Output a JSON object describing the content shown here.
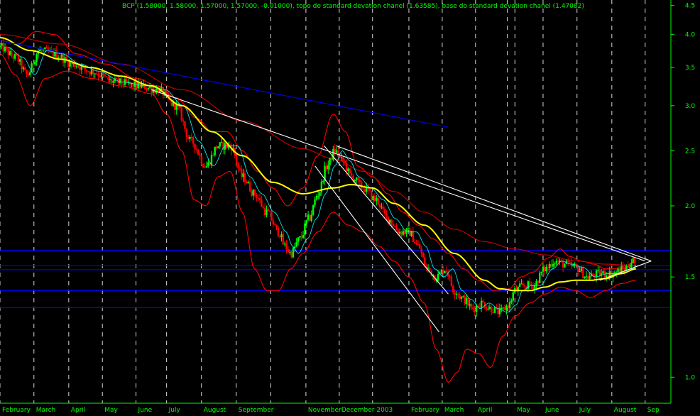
{
  "header": {
    "title": "BCP (1.58000, 1.58000, 1.57000, 1.57000, -0.01000), topo do standard devation chanel (1.63585), base do standard devation chanel (1.47082)"
  },
  "colors": {
    "background": "#000000",
    "grid": "#ffffff",
    "axis": "#00ff00",
    "title": "#00ff00",
    "candle_up": "#00ff00",
    "candle_down": "#ff0000",
    "ma_long": "#ffff00",
    "bands": "#ff0000",
    "hlines": "#0000ff",
    "trend_white": "#ffffff",
    "trend_blue": "#0000ff"
  },
  "chart_data": {
    "type": "line",
    "yscale": "log",
    "ylim": [
      0.9,
      4.6
    ],
    "yticks": [
      {
        "v": 1.0,
        "label": "1.0"
      },
      {
        "v": 1.5,
        "label": "1.5"
      },
      {
        "v": 2.0,
        "label": "2.0"
      },
      {
        "v": 2.5,
        "label": "2.5"
      },
      {
        "v": 3.0,
        "label": "3.0"
      },
      {
        "v": 3.5,
        "label": "3.5"
      },
      {
        "v": 4.0,
        "label": "4.0"
      },
      {
        "v": 4.5,
        "label": "4.5"
      }
    ],
    "xlim": [
      0,
      22.15
    ],
    "months": [
      {
        "label": "February",
        "x": 0.0
      },
      {
        "label": "March",
        "x": 1.12
      },
      {
        "label": "April",
        "x": 2.27
      },
      {
        "label": "May",
        "x": 3.38
      },
      {
        "label": "June",
        "x": 4.49
      },
      {
        "label": "July",
        "x": 5.5
      },
      {
        "label": "August",
        "x": 6.65
      },
      {
        "label": "September",
        "x": 7.8
      },
      {
        "label": "",
        "x": 8.94
      },
      {
        "label": "November",
        "x": 10.1
      },
      {
        "label": "December 2003",
        "x": 11.2
      },
      {
        "label": "",
        "x": 12.3
      },
      {
        "label": "February",
        "x": 13.5
      },
      {
        "label": "March",
        "x": 14.6
      },
      {
        "label": "April",
        "x": 15.7
      },
      {
        "label": "",
        "x": 16.75
      },
      {
        "label": "May",
        "x": 17.0
      },
      {
        "label": "June",
        "x": 17.93
      },
      {
        "label": "July",
        "x": 19.05
      },
      {
        "label": "August",
        "x": 20.2
      },
      {
        "label": "Sep",
        "x": 21.3
      }
    ],
    "price_anchors": [
      [
        0.0,
        3.8
      ],
      [
        0.5,
        3.65
      ],
      [
        0.9,
        3.4
      ],
      [
        1.3,
        3.75
      ],
      [
        1.8,
        3.7
      ],
      [
        2.4,
        3.55
      ],
      [
        3.0,
        3.45
      ],
      [
        3.8,
        3.3
      ],
      [
        4.6,
        3.25
      ],
      [
        5.2,
        3.2
      ],
      [
        5.8,
        3.0
      ],
      [
        6.3,
        2.6
      ],
      [
        6.8,
        2.35
      ],
      [
        7.2,
        2.55
      ],
      [
        7.6,
        2.55
      ],
      [
        8.0,
        2.25
      ],
      [
        8.4,
        2.1
      ],
      [
        8.8,
        1.95
      ],
      [
        9.2,
        1.8
      ],
      [
        9.4,
        1.7
      ],
      [
        9.6,
        1.65
      ],
      [
        9.9,
        1.75
      ],
      [
        10.2,
        1.9
      ],
      [
        10.5,
        2.1
      ],
      [
        10.8,
        2.35
      ],
      [
        11.05,
        2.5
      ],
      [
        11.3,
        2.4
      ],
      [
        11.6,
        2.25
      ],
      [
        12.0,
        2.15
      ],
      [
        12.4,
        2.05
      ],
      [
        12.8,
        1.9
      ],
      [
        13.2,
        1.8
      ],
      [
        13.5,
        1.8
      ],
      [
        13.8,
        1.7
      ],
      [
        14.1,
        1.55
      ],
      [
        14.4,
        1.5
      ],
      [
        14.7,
        1.55
      ],
      [
        15.0,
        1.42
      ],
      [
        15.3,
        1.37
      ],
      [
        15.6,
        1.32
      ],
      [
        15.9,
        1.35
      ],
      [
        16.2,
        1.32
      ],
      [
        16.5,
        1.3
      ],
      [
        16.8,
        1.34
      ],
      [
        17.0,
        1.42
      ],
      [
        17.3,
        1.45
      ],
      [
        17.6,
        1.45
      ],
      [
        18.0,
        1.55
      ],
      [
        18.3,
        1.6
      ],
      [
        18.6,
        1.58
      ],
      [
        19.0,
        1.56
      ],
      [
        19.4,
        1.5
      ],
      [
        19.8,
        1.52
      ],
      [
        20.2,
        1.52
      ],
      [
        20.6,
        1.55
      ],
      [
        20.9,
        1.6
      ],
      [
        21.0,
        1.57
      ]
    ],
    "ma_long_anchors": [
      [
        0.0,
        3.95
      ],
      [
        1.0,
        3.75
      ],
      [
        2.0,
        3.62
      ],
      [
        3.0,
        3.5
      ],
      [
        4.0,
        3.38
      ],
      [
        5.0,
        3.25
      ],
      [
        6.0,
        3.0
      ],
      [
        7.0,
        2.7
      ],
      [
        8.0,
        2.45
      ],
      [
        9.0,
        2.2
      ],
      [
        10.0,
        2.1
      ],
      [
        11.0,
        2.15
      ],
      [
        11.6,
        2.18
      ],
      [
        12.3,
        2.15
      ],
      [
        13.0,
        2.02
      ],
      [
        14.0,
        1.85
      ],
      [
        15.0,
        1.65
      ],
      [
        16.0,
        1.48
      ],
      [
        16.5,
        1.43
      ],
      [
        17.0,
        1.42
      ],
      [
        17.5,
        1.42
      ],
      [
        18.0,
        1.44
      ],
      [
        18.5,
        1.47
      ],
      [
        19.0,
        1.48
      ],
      [
        19.5,
        1.48
      ],
      [
        20.0,
        1.49
      ],
      [
        20.5,
        1.52
      ],
      [
        21.0,
        1.55
      ]
    ],
    "band_upper_anchors": [
      [
        0.0,
        3.9
      ],
      [
        0.6,
        3.85
      ],
      [
        1.2,
        4.05
      ],
      [
        1.8,
        4.0
      ],
      [
        2.5,
        3.7
      ],
      [
        3.5,
        3.55
      ],
      [
        4.5,
        3.35
      ],
      [
        5.2,
        3.25
      ],
      [
        5.8,
        3.1
      ],
      [
        6.5,
        2.85
      ],
      [
        7.0,
        2.7
      ],
      [
        7.5,
        2.7
      ],
      [
        8.0,
        2.5
      ],
      [
        8.5,
        2.3
      ],
      [
        9.0,
        2.15
      ],
      [
        9.5,
        2.0
      ],
      [
        10.0,
        2.15
      ],
      [
        10.5,
        2.45
      ],
      [
        11.0,
        2.9
      ],
      [
        11.4,
        2.7
      ],
      [
        11.8,
        2.35
      ],
      [
        12.3,
        2.25
      ],
      [
        12.8,
        2.1
      ],
      [
        13.3,
        1.95
      ],
      [
        13.8,
        1.85
      ],
      [
        14.3,
        1.75
      ],
      [
        14.8,
        1.65
      ],
      [
        15.3,
        1.55
      ],
      [
        15.8,
        1.48
      ],
      [
        16.3,
        1.42
      ],
      [
        16.8,
        1.43
      ],
      [
        17.2,
        1.5
      ],
      [
        17.6,
        1.53
      ],
      [
        18.1,
        1.62
      ],
      [
        18.5,
        1.68
      ],
      [
        18.8,
        1.63
      ],
      [
        19.2,
        1.6
      ],
      [
        19.6,
        1.58
      ],
      [
        20.0,
        1.55
      ],
      [
        20.5,
        1.55
      ],
      [
        21.0,
        1.6
      ]
    ],
    "band_lower_anchors": [
      [
        0.0,
        3.7
      ],
      [
        0.5,
        3.4
      ],
      [
        1.0,
        3.0
      ],
      [
        1.5,
        3.35
      ],
      [
        2.2,
        3.45
      ],
      [
        3.0,
        3.35
      ],
      [
        4.0,
        3.25
      ],
      [
        5.0,
        3.15
      ],
      [
        5.5,
        2.9
      ],
      [
        6.0,
        2.5
      ],
      [
        6.4,
        2.05
      ],
      [
        6.8,
        2.0
      ],
      [
        7.2,
        2.25
      ],
      [
        7.6,
        2.3
      ],
      [
        8.0,
        1.95
      ],
      [
        8.4,
        1.55
      ],
      [
        8.8,
        1.42
      ],
      [
        9.2,
        1.42
      ],
      [
        9.6,
        1.55
      ],
      [
        10.0,
        1.65
      ],
      [
        10.5,
        1.8
      ],
      [
        11.0,
        1.95
      ],
      [
        11.5,
        1.85
      ],
      [
        12.0,
        1.8
      ],
      [
        12.5,
        1.7
      ],
      [
        13.0,
        1.6
      ],
      [
        13.5,
        1.5
      ],
      [
        14.0,
        1.35
      ],
      [
        14.4,
        1.12
      ],
      [
        14.8,
        0.98
      ],
      [
        15.1,
        1.02
      ],
      [
        15.4,
        1.12
      ],
      [
        15.8,
        1.1
      ],
      [
        16.2,
        1.04
      ],
      [
        16.6,
        1.18
      ],
      [
        17.0,
        1.28
      ],
      [
        17.5,
        1.35
      ],
      [
        18.0,
        1.4
      ],
      [
        18.5,
        1.44
      ],
      [
        19.0,
        1.42
      ],
      [
        19.5,
        1.38
      ],
      [
        20.0,
        1.42
      ],
      [
        20.5,
        1.46
      ],
      [
        21.0,
        1.48
      ]
    ],
    "ma_mid_anchors": [
      [
        0.0,
        4.0
      ],
      [
        2.0,
        3.85
      ],
      [
        4.0,
        3.55
      ],
      [
        6.0,
        3.2
      ],
      [
        8.0,
        2.82
      ],
      [
        10.0,
        2.52
      ],
      [
        11.0,
        2.42
      ],
      [
        12.0,
        2.3
      ],
      [
        13.0,
        2.12
      ],
      [
        14.0,
        1.95
      ],
      [
        15.0,
        1.82
      ],
      [
        16.0,
        1.73
      ],
      [
        17.0,
        1.68
      ],
      [
        18.0,
        1.64
      ],
      [
        19.0,
        1.6
      ],
      [
        20.0,
        1.58
      ],
      [
        21.0,
        1.57
      ]
    ],
    "hlines": [
      1.67,
      1.57,
      1.545,
      1.42,
      1.325
    ],
    "trendlines": [
      {
        "color": "white",
        "x1": 5.0,
        "y1": 3.2,
        "x2": 21.3,
        "y2": 1.6
      },
      {
        "color": "white",
        "x1": 11.1,
        "y1": 2.55,
        "x2": 21.5,
        "y2": 1.6
      },
      {
        "color": "white",
        "x1": 10.7,
        "y1": 2.55,
        "x2": 14.8,
        "y2": 1.4
      },
      {
        "color": "white",
        "x1": 10.4,
        "y1": 2.35,
        "x2": 14.5,
        "y2": 1.2
      },
      {
        "color": "white",
        "x1": 19.8,
        "y1": 1.48,
        "x2": 21.5,
        "y2": 1.6
      },
      {
        "color": "blue",
        "x1": 0.0,
        "y1": 3.9,
        "x2": 14.8,
        "y2": 2.75
      }
    ],
    "price_last": 1.57,
    "channel_top": 1.63585,
    "channel_base": 1.47082
  }
}
